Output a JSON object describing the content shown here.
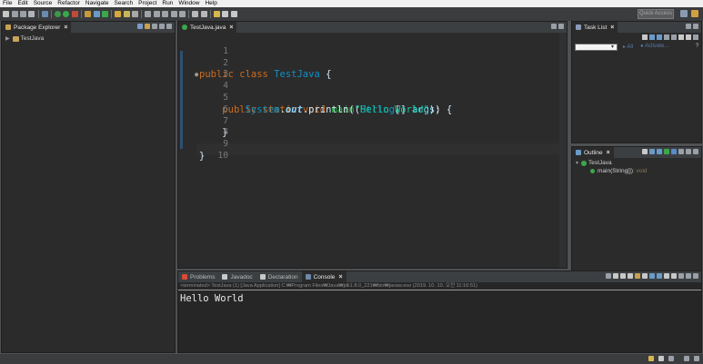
{
  "menubar": {
    "items": [
      "File",
      "Edit",
      "Source",
      "Refactor",
      "Navigate",
      "Search",
      "Project",
      "Run",
      "Window",
      "Help"
    ]
  },
  "toolbar": {
    "quick_access_placeholder": "Quick Access"
  },
  "package_explorer": {
    "tab_label": "Package Explorer",
    "tree": [
      {
        "label": "TestJava",
        "expanded": false
      }
    ]
  },
  "editor": {
    "tab_label": "TestJava.java",
    "lines": [
      {
        "n": "1"
      },
      {
        "n": "2"
      },
      {
        "n": "3"
      },
      {
        "n": "4"
      },
      {
        "n": "5"
      },
      {
        "n": "6"
      },
      {
        "n": "7"
      },
      {
        "n": "8"
      },
      {
        "n": "9"
      },
      {
        "n": "10"
      }
    ],
    "code": {
      "l2_public": "public",
      "l2_class": "class",
      "l2_name": "TestJava",
      "l2_brace": " {",
      "l4_public": "public",
      "l4_static": "static",
      "l4_void": "void",
      "l4_main": "main",
      "l4_type": "String",
      "l4_args": "args",
      "l4_rest": ") {",
      "l5_sys": "System",
      "l5_out": "out",
      "l5_println": ".println(",
      "l5_str": "\"Hello World\"",
      "l5_end": ");",
      "l7": "}",
      "l9": "}"
    }
  },
  "task_list": {
    "tab_label": "Task List",
    "filter_all": "All",
    "filter_activate": "Activate..."
  },
  "outline": {
    "tab_label": "Outline",
    "class_name": "TestJava",
    "method": "main(String[])",
    "method_return": " : void"
  },
  "bottom_tabs": [
    {
      "label": "Problems"
    },
    {
      "label": "Javadoc"
    },
    {
      "label": "Declaration"
    },
    {
      "label": "Console"
    }
  ],
  "console": {
    "header": "<terminated> TestJava (1) [Java Application] C:₩Program Files₩Java₩jdk1.8.0_221₩bin₩javaw.exe (2019. 10. 10. 오전 11:16:51)",
    "output": "Hello World"
  },
  "colors": {
    "keyword": "#cc6c1d",
    "string": "#17c6a3",
    "method": "#1eb540",
    "background": "#2b2b2b"
  }
}
